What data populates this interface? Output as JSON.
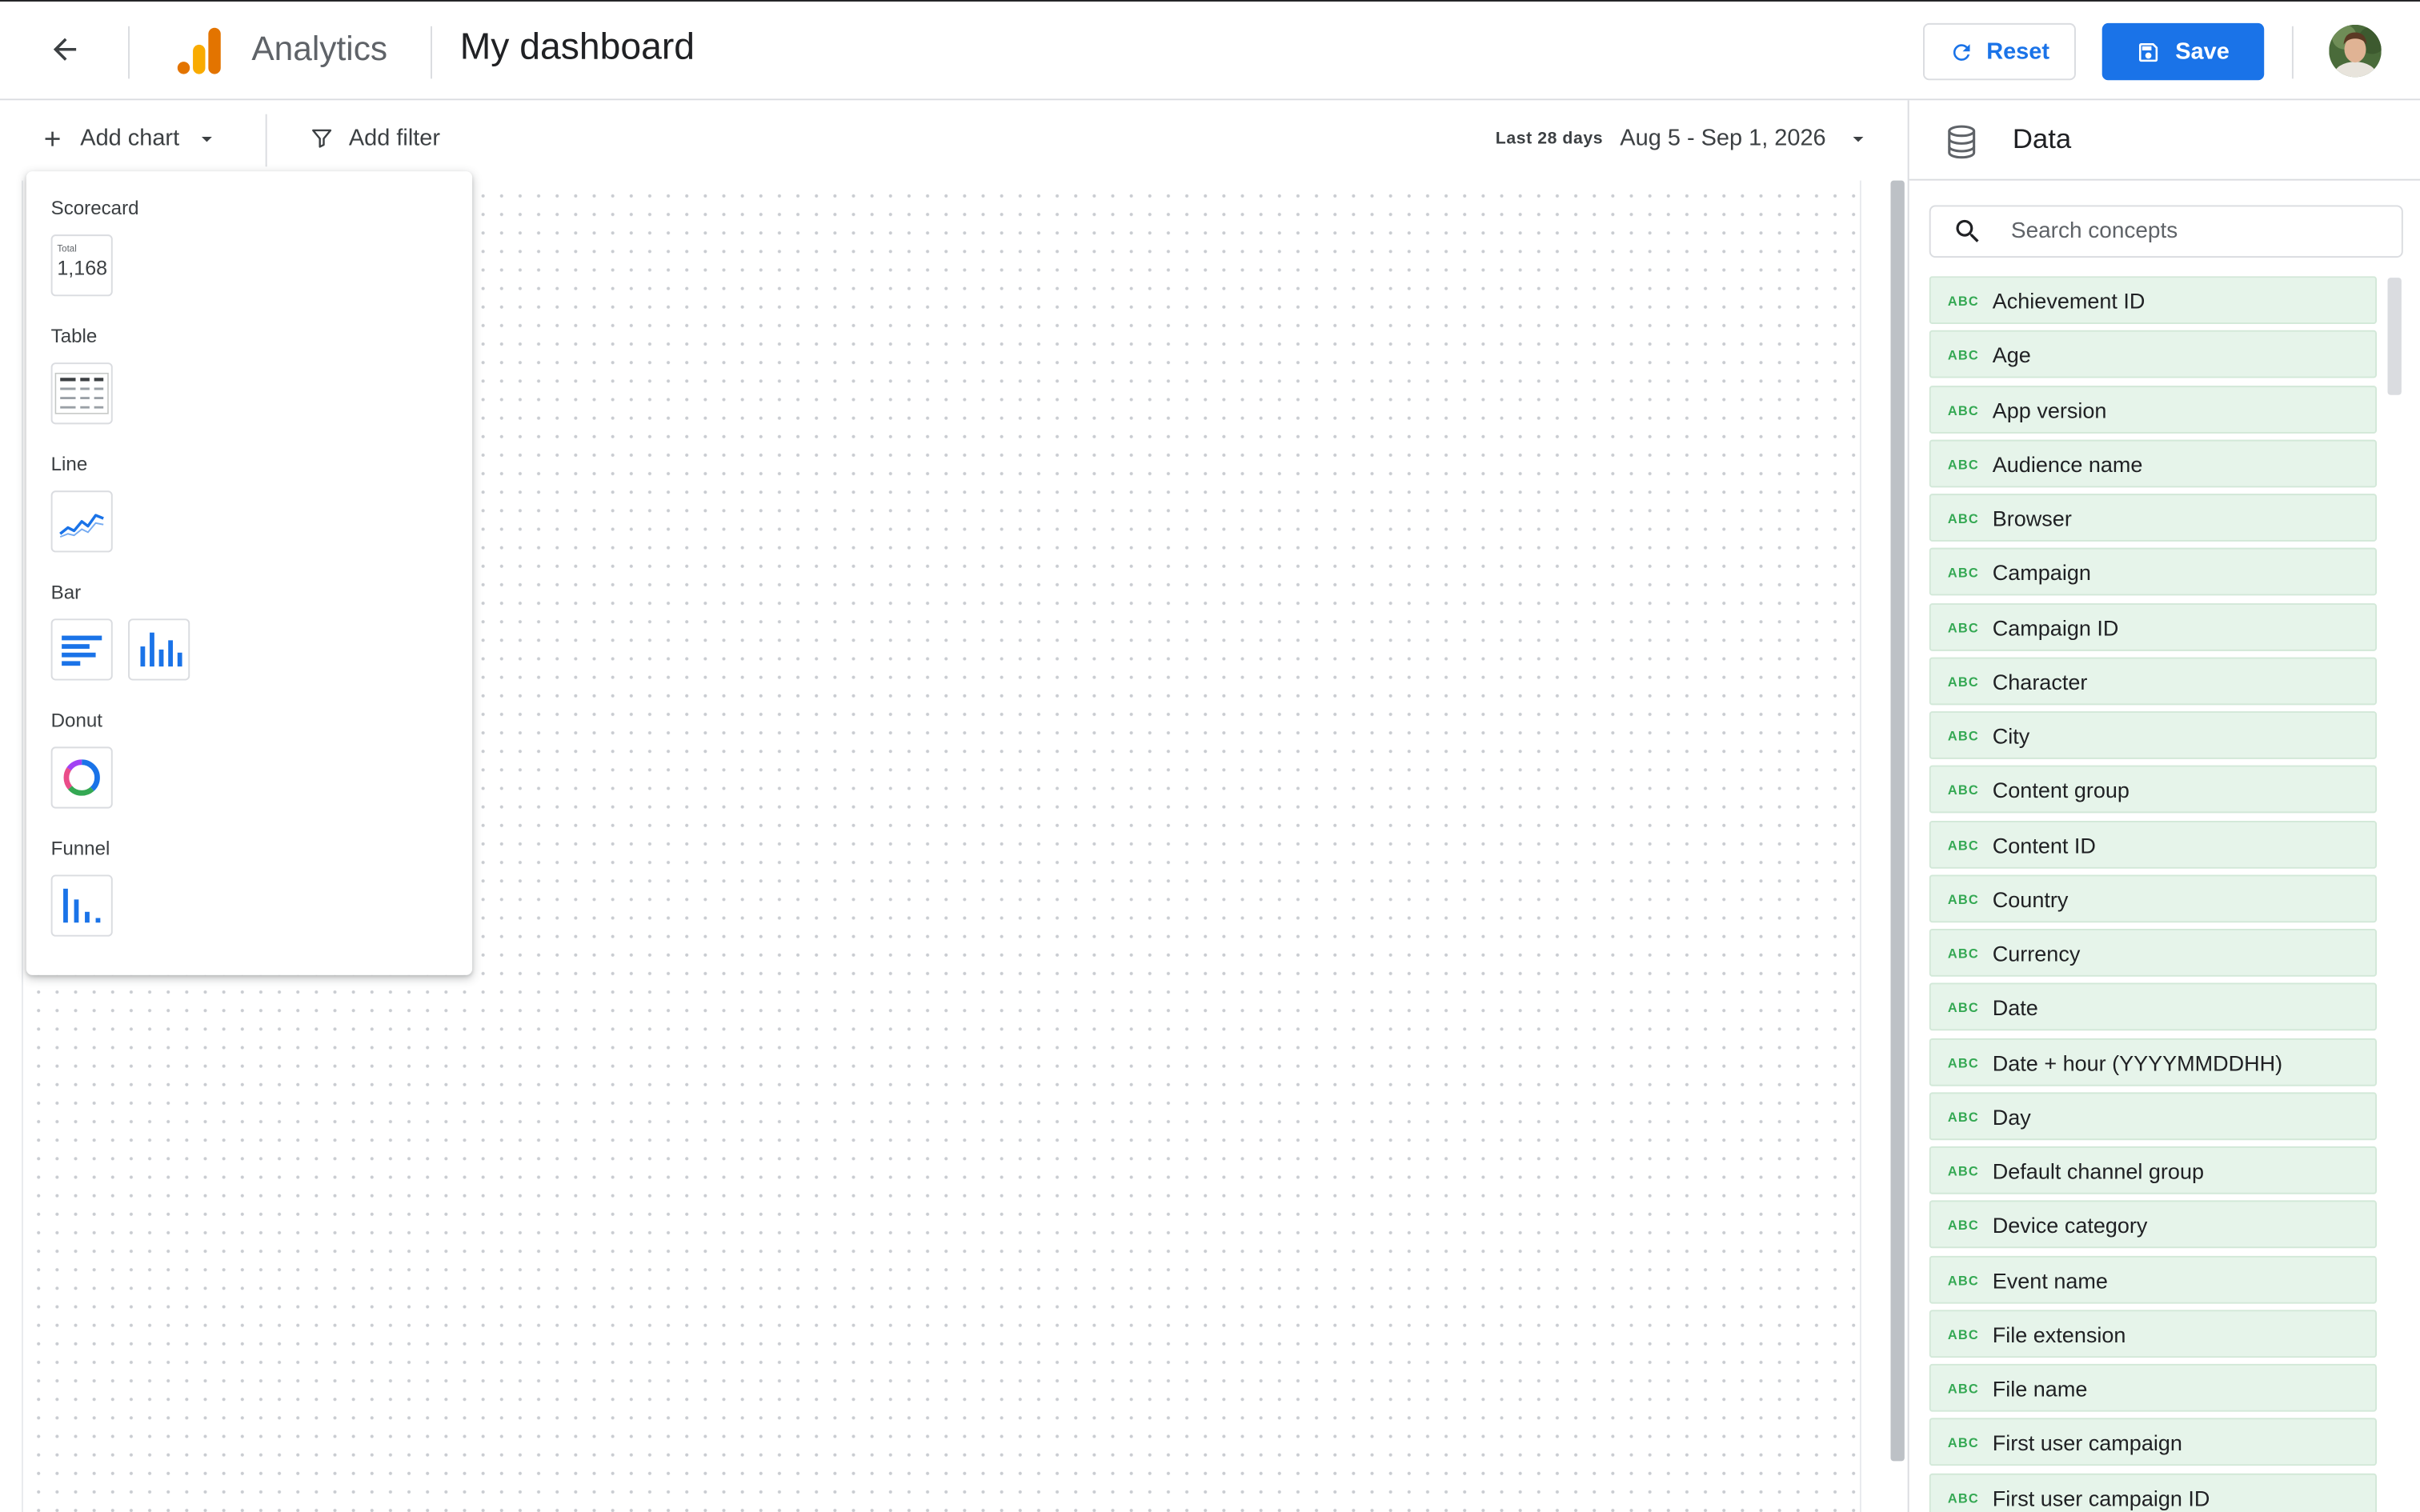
{
  "header": {
    "app_name": "Analytics",
    "page_title": "My dashboard",
    "reset_label": "Reset",
    "save_label": "Save",
    "icons": [
      "back-arrow-icon",
      "analytics-logo-icon",
      "refresh-icon",
      "save-disk-icon"
    ],
    "colors": {
      "primary": "#1a73e8",
      "logo_orange": "#f9ab00",
      "logo_dark_orange": "#e37400"
    }
  },
  "toolbar": {
    "add_chart_label": "Add chart",
    "add_filter_label": "Add filter",
    "date_preset": "Last 28 days",
    "date_range": "Aug 5 - Sep 1, 2026"
  },
  "chart_menu": {
    "sections": [
      {
        "label": "Scorecard"
      },
      {
        "label": "Table"
      },
      {
        "label": "Line"
      },
      {
        "label": "Bar"
      },
      {
        "label": "Donut"
      },
      {
        "label": "Funnel"
      }
    ],
    "scorecard_preview": {
      "caption": "Total",
      "value": "1,168"
    }
  },
  "data_panel": {
    "title": "Data",
    "search_placeholder": "Search concepts",
    "type_badge": "ABC",
    "concept_color": "#e6f4ea",
    "items": [
      "Achievement ID",
      "Age",
      "App version",
      "Audience name",
      "Browser",
      "Campaign",
      "Campaign ID",
      "Character",
      "City",
      "Content group",
      "Content ID",
      "Country",
      "Currency",
      "Date",
      "Date + hour (YYYYMMDDHH)",
      "Day",
      "Default channel group",
      "Device category",
      "Event name",
      "File extension",
      "File name",
      "First user campaign",
      "First user campaign ID"
    ]
  }
}
